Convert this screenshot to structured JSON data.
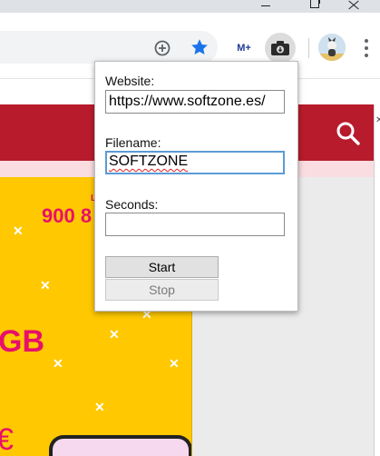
{
  "popup": {
    "website_label": "Website:",
    "website_value": "https://www.softzone.es/",
    "filename_label": "Filename:",
    "filename_value": "SOFTZONE",
    "seconds_label": "Seconds:",
    "seconds_value": "",
    "start_label": "Start",
    "stop_label": "Stop"
  },
  "promo": {
    "price_text": "900 8",
    "tiny_text": "L",
    "gb_text": "GB",
    "currency_text": "€"
  },
  "toolbar": {
    "movistar_text": "M+",
    "icons": [
      "zoom-icon",
      "bookmark-star-icon",
      "movistar-extension-icon",
      "screen-capture-extension-icon",
      "profile-avatar",
      "chrome-menu-icon"
    ]
  },
  "colors": {
    "brand_red": "#b81c2c",
    "promo_yellow": "#ffc800",
    "promo_pink": "#e8106a",
    "star_blue": "#1a73e8"
  }
}
